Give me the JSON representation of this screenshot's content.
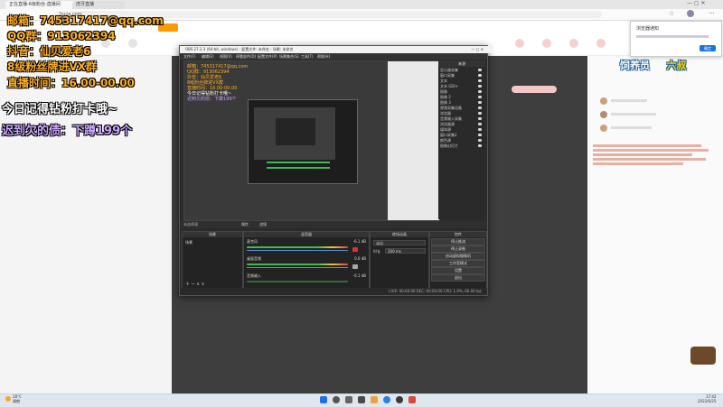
{
  "browser": {
    "tab1": "正在直播-6级粉丝-直播间",
    "tab2": "虎牙直播",
    "url": "huya.com"
  },
  "overlay": {
    "email": "邮箱：745317417@qq.com",
    "qq_group": "QQ群：913062394",
    "douyin": "抖音：仙贝爱老6",
    "fan_group": "8级粉丝牌进VX群",
    "live_time": "直播时间：16.00-00.00",
    "reminder": "今日记得钻粉打卡哦~",
    "debt": "迟到欠的债：下蹲199个"
  },
  "chat": {
    "badge_title": "饲养员",
    "badge_name": "六叔",
    "notify_title": "浏览器通知",
    "notify_btn": "确定"
  },
  "obs": {
    "title": "OBS 27.2.3 (64-bit, windows) - 配置文件: 未命名 - 场景: 未命名",
    "menu": [
      "文件(F)",
      "编辑(E)",
      "视图(V)",
      "停靠部件(D)",
      "配置文件(P)",
      "场景集合(S)",
      "工具(T)",
      "帮助(H)"
    ],
    "sources_header": "来源",
    "sources": [
      "显示器采集",
      "窗口采集",
      "文本",
      "文本 GDI+",
      "图像",
      "图像 2",
      "图像 3",
      "视频采集设备",
      "浏览器",
      "音频输入采集",
      "浏览器源",
      "媒体源",
      "窗口采集2",
      "颜色源",
      "图像幻灯片"
    ],
    "toolbar_label": "未选择源",
    "toolbar_props": "属性",
    "toolbar_filters": "滤镜",
    "scenes_header": "场景",
    "scene_item": "场景",
    "mixer_header": "混音器",
    "mixer": [
      {
        "name": "麦克风",
        "db": "-6.1 dB"
      },
      {
        "name": "桌面音频",
        "db": "0.0 dB"
      },
      {
        "name": "音频输入",
        "db": "-6.1 dB"
      }
    ],
    "transitions_header": "转场动画",
    "transition_type": "淡出",
    "duration_label": "时长",
    "duration_value": "300 ms",
    "controls_header": "控件",
    "controls": [
      "停止推流",
      "停止录制",
      "启动虚拟摄像机",
      "工作室模式",
      "设置",
      "退出"
    ],
    "status": "LIVE: 00:00:00   REC: 00:00:00   CPU: 1.9%, 60.00 fps"
  },
  "taskbar": {
    "weather": "28°C",
    "weather_desc": "晴朗",
    "time": "17:42",
    "date": "2022/6/25"
  }
}
